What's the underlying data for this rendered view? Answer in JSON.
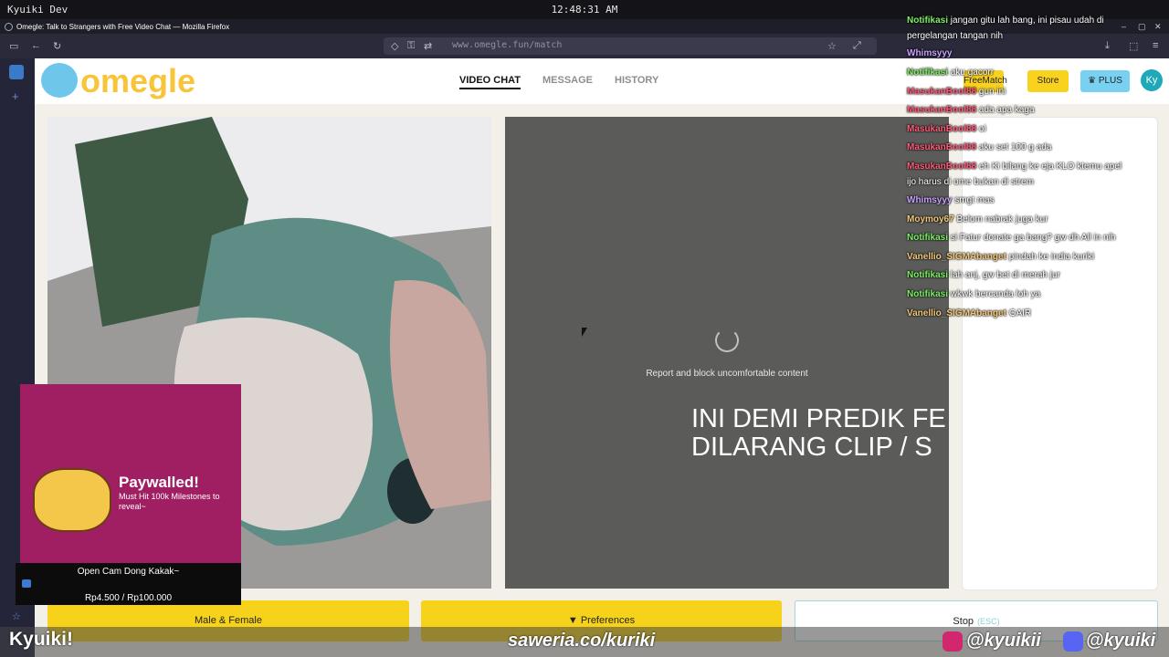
{
  "system": {
    "workspace": "Kyuiki Dev",
    "clock": "12:48:31 AM"
  },
  "window": {
    "title": "Omegle: Talk to Strangers with Free Video Chat — Mozilla Firefox"
  },
  "browser": {
    "url": "www.omegle.fun/match"
  },
  "site": {
    "logo_text": "omegle",
    "tabs": [
      "VIDEO CHAT",
      "MESSAGE",
      "HISTORY"
    ],
    "free_match": "FreeMatch",
    "store": "Store",
    "plus": "PLUS",
    "avatar": "Ky"
  },
  "stage": {
    "report_text": "Report and block uncomfortable content"
  },
  "buttons": {
    "gender": "Male & Female",
    "preferences": "Preferences",
    "stop": "Stop",
    "stop_hint": "(ESC)"
  },
  "overlay": {
    "paywall_title": "Paywalled!",
    "paywall_sub": "Must Hit 100k Milestones to reveal~",
    "goal_title": "Open Cam Dong Kakak~",
    "goal_amount": "Rp4.500 / Rp100.000",
    "warning_line1": "INI DEMI PREDIK FE",
    "warning_line2": "DILARANG CLIP / S"
  },
  "chat": [
    {
      "name": "Notifikasi",
      "color": "#7cf062",
      "text": "jangan gitu lah bang, ini pisau udah di"
    },
    {
      "name": "",
      "color": "#ffffff",
      "text": "pergelangan tangan nih"
    },
    {
      "name": "Whimsyyy",
      "color": "#c8a2ff",
      "text": ""
    },
    {
      "name": "Notifikasi",
      "color": "#7cf062",
      "text": "aku gacorr"
    },
    {
      "name": "MasukanBool88",
      "color": "#ff5a7a",
      "text": "gun ini"
    },
    {
      "name": "MasukanBool88",
      "color": "#ff5a7a",
      "text": "ada apa kaga"
    },
    {
      "name": "MasukanBool88",
      "color": "#ff5a7a",
      "text": "oi"
    },
    {
      "name": "MasukanBool88",
      "color": "#ff5a7a",
      "text": "aku set 100 g ada"
    },
    {
      "name": "MasukanBool88",
      "color": "#ff5a7a",
      "text": "eh Ki bilang ke eja KLO ktemu apel"
    },
    {
      "name": "",
      "color": "#ffffff",
      "text": "ijo harus di ome bukan di strem"
    },
    {
      "name": "Whimsyyy",
      "color": "#c8a2ff",
      "text": "smgt mas"
    },
    {
      "name": "Moymoy67",
      "color": "#f3c77a",
      "text": "Belom nabrak juga kur"
    },
    {
      "name": "Notifikasi",
      "color": "#7cf062",
      "text": "si Fatur donate ga bang? gw dh All in nih"
    },
    {
      "name": "Vanellio_SIGMAbanget",
      "color": "#f3c77a",
      "text": "pindah ke india kuriki"
    },
    {
      "name": "Notifikasi",
      "color": "#7cf062",
      "text": "lah anj, gw bet di merah jur"
    },
    {
      "name": "Notifikasi",
      "color": "#7cf062",
      "text": "wkwk bercanda loh ya"
    },
    {
      "name": "Vanellio_SIGMAbanget",
      "color": "#f3c77a",
      "text": "GAIR"
    }
  ],
  "footer": {
    "streamer": "Kyuiki!",
    "saweria": "saweria.co/kuriki",
    "instagram": "@kyuikii",
    "discord": "@kyuiki"
  }
}
